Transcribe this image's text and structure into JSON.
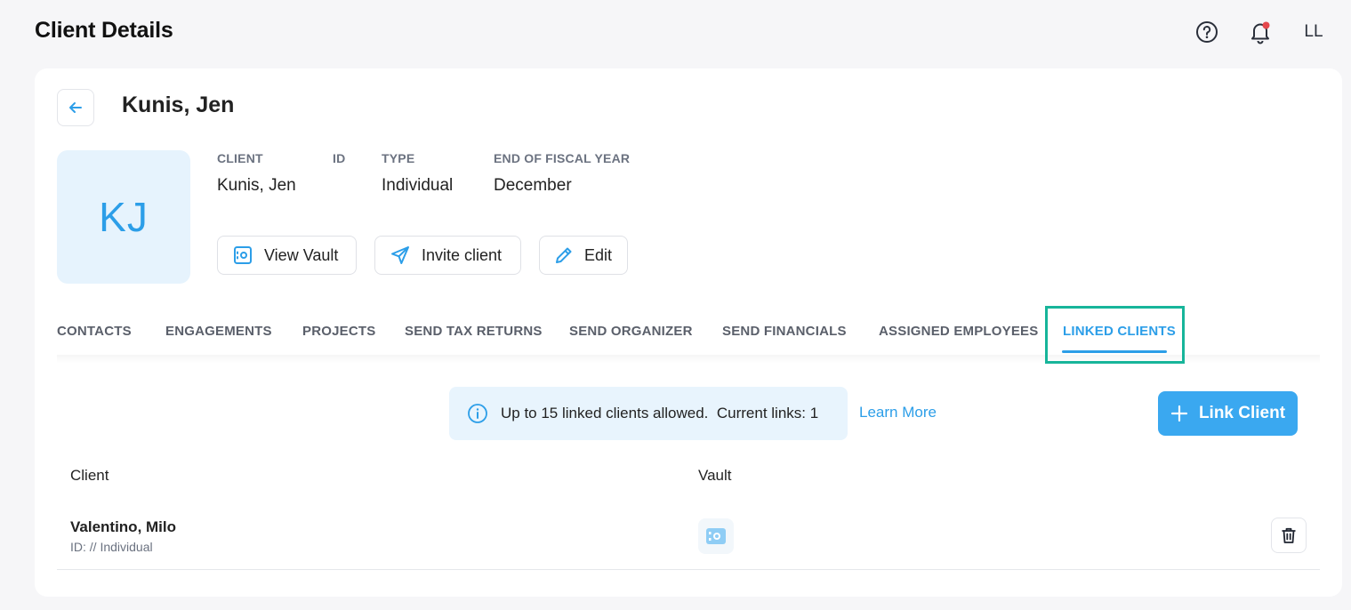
{
  "header": {
    "title": "Client Details",
    "help_icon": "help-circle-icon",
    "bell_icon": "bell-icon",
    "user_initials": "LL",
    "notification_color": "#e5484d"
  },
  "client": {
    "name": "Kunis, Jen",
    "initials": "KJ",
    "fields": {
      "client_label": "CLIENT",
      "client_value": "Kunis, Jen",
      "id_label": "ID",
      "id_value": "",
      "type_label": "TYPE",
      "type_value": "Individual",
      "fiscal_label": "END OF FISCAL YEAR",
      "fiscal_value": "December"
    },
    "actions": {
      "view_vault": "View Vault",
      "invite_client": "Invite client",
      "edit": "Edit"
    }
  },
  "tabs": [
    {
      "label": "CONTACTS"
    },
    {
      "label": "ENGAGEMENTS"
    },
    {
      "label": "PROJECTS"
    },
    {
      "label": "SEND TAX RETURNS"
    },
    {
      "label": "SEND ORGANIZER"
    },
    {
      "label": "SEND FINANCIALS"
    },
    {
      "label": "ASSIGNED EMPLOYEES"
    },
    {
      "label": "LINKED CLIENTS",
      "active": true
    }
  ],
  "linked": {
    "banner_text": "Up to 15 linked clients allowed.  Current links: 1",
    "learn_more": "Learn More",
    "link_button": "Link Client",
    "columns": {
      "client": "Client",
      "vault": "Vault"
    },
    "rows": [
      {
        "name": "Valentino, Milo",
        "sub": "ID: // Individual"
      }
    ]
  },
  "colors": {
    "accent": "#2c9ee8",
    "highlight": "#17b59a"
  }
}
